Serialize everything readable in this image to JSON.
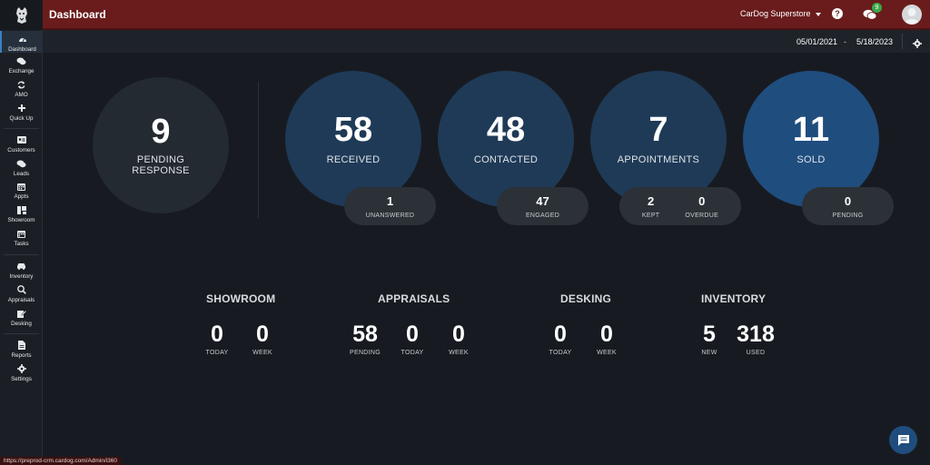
{
  "header": {
    "title": "Dashboard",
    "store": "CarDog Superstore",
    "help": "?",
    "chat_badge": "9"
  },
  "sidebar": {
    "items": [
      {
        "label": "Dashboard",
        "icon": "gauge-icon",
        "active": true
      },
      {
        "label": "Exchange",
        "icon": "chat-bubbles-icon"
      },
      {
        "label": "AMO",
        "icon": "refresh-icon"
      },
      {
        "label": "Quick Up",
        "icon": "plus-icon"
      },
      {
        "label": "Customers",
        "icon": "id-card-icon"
      },
      {
        "label": "Leads",
        "icon": "comments-icon"
      },
      {
        "label": "Appts",
        "icon": "calendar-icon"
      },
      {
        "label": "Showroom",
        "icon": "showroom-icon"
      },
      {
        "label": "Tasks",
        "icon": "calendar-check-icon"
      },
      {
        "label": "Inventory",
        "icon": "car-icon"
      },
      {
        "label": "Appraisals",
        "icon": "search-dollar-icon"
      },
      {
        "label": "Desking",
        "icon": "edit-icon"
      },
      {
        "label": "Reports",
        "icon": "file-icon"
      },
      {
        "label": "Settings",
        "icon": "gear-icon"
      }
    ]
  },
  "daterange": {
    "from": "05/01/2021",
    "separator": "-",
    "to": "5/18/2023"
  },
  "summary": {
    "pending": {
      "value": "9",
      "label_line1": "PENDING",
      "label_line2": "RESPONSE"
    },
    "received": {
      "value": "58",
      "label": "RECEIVED",
      "sub": [
        {
          "value": "1",
          "label": "UNANSWERED"
        }
      ]
    },
    "contacted": {
      "value": "48",
      "label": "CONTACTED",
      "sub": [
        {
          "value": "47",
          "label": "ENGAGED"
        }
      ]
    },
    "appointments": {
      "value": "7",
      "label": "APPOINTMENTS",
      "sub": [
        {
          "value": "2",
          "label": "KEPT"
        },
        {
          "value": "0",
          "label": "OVERDUE"
        }
      ]
    },
    "sold": {
      "value": "11",
      "label": "SOLD",
      "sub": [
        {
          "value": "0",
          "label": "PENDING"
        }
      ]
    }
  },
  "stats": {
    "showroom": {
      "title": "SHOWROOM",
      "items": [
        {
          "value": "0",
          "label": "TODAY"
        },
        {
          "value": "0",
          "label": "WEEK"
        }
      ]
    },
    "appraisals": {
      "title": "APPRAISALS",
      "items": [
        {
          "value": "58",
          "label": "PENDING"
        },
        {
          "value": "0",
          "label": "TODAY"
        },
        {
          "value": "0",
          "label": "WEEK"
        }
      ]
    },
    "desking": {
      "title": "DESKING",
      "items": [
        {
          "value": "0",
          "label": "TODAY"
        },
        {
          "value": "0",
          "label": "WEEK"
        }
      ]
    },
    "inventory": {
      "title": "INVENTORY",
      "items": [
        {
          "value": "5",
          "label": "NEW"
        },
        {
          "value": "318",
          "label": "USED"
        }
      ]
    }
  },
  "footer": {
    "status_url": "https://preprod-crm.cardog.com/Admin/i360"
  },
  "colors": {
    "header": "#6a1c1c",
    "accent_blue": "#1f4d7e",
    "badge_green": "#3aa84a"
  }
}
